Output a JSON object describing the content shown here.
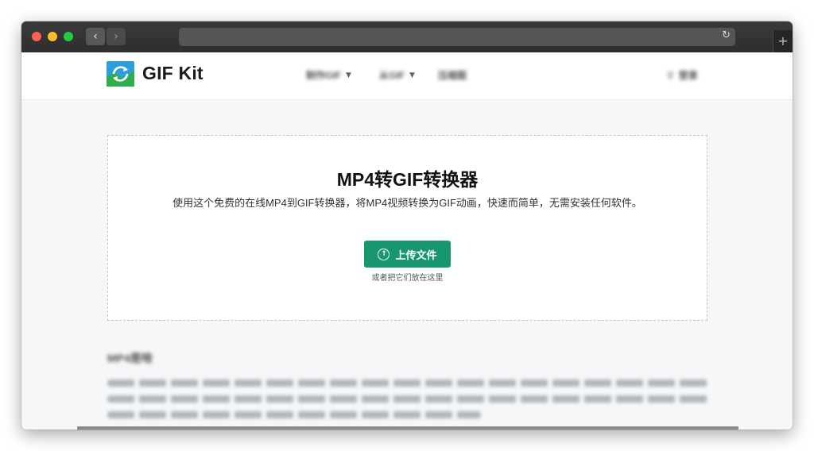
{
  "site": {
    "brand": "GIF Kit"
  },
  "header": {
    "menu": [
      {
        "label": "制作GIF"
      },
      {
        "label": "从GIF"
      },
      {
        "label": "压缩图"
      }
    ],
    "search_label": "登录"
  },
  "converter": {
    "title": "MP4转GIF转换器",
    "subtitle": "使用这个免费的在线MP4到GIF转换器，将MP4视频转换为GIF动画，快速而简单，无需安装任何软件。",
    "upload_label": "上传文件",
    "drop_hint": "或者把它们放在这里"
  },
  "about": {
    "title": "MP4是啥"
  },
  "colors": {
    "accent": "#17966f",
    "titlebar": "#2e2e2e"
  },
  "icons": {
    "upload": "upload-icon",
    "search": "search-icon",
    "reload": "reload-icon"
  }
}
